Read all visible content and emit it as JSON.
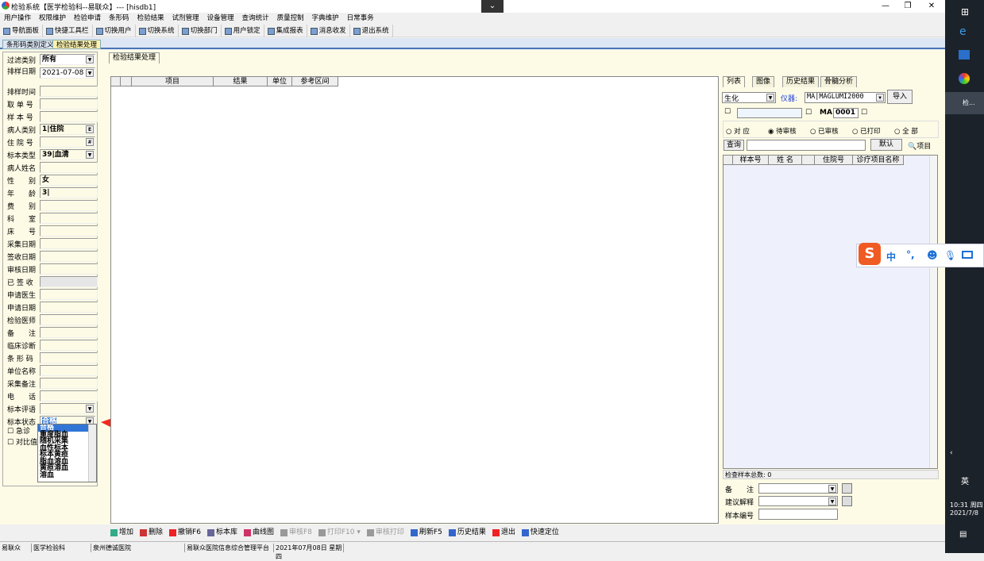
{
  "window": {
    "title": "检验系统【医学检验科--易联众】--- [hisdb1]",
    "minimize": "—",
    "maximize": "❐",
    "close": "✕",
    "collapse": "⌄"
  },
  "menu": [
    "用户操作",
    "权限维护",
    "检验申请",
    "条形码",
    "检验结果",
    "试剂管理",
    "设备管理",
    "查询统计",
    "质量控制",
    "字典维护",
    "日常事务"
  ],
  "toolbar": [
    "导航面板",
    "快捷工具栏",
    "切换用户",
    "切换系统",
    "切换部门",
    "用户锁定",
    "集成报表",
    "消息收发",
    "退出系统"
  ],
  "doc_tabs": [
    {
      "label": "条形码类别定义",
      "active": false
    },
    {
      "label": "检验结果处理",
      "active": true
    }
  ],
  "left": {
    "filter_label": "过滤类别",
    "filter_value": "所有",
    "date_label": "排样日期",
    "date_value": "2021-07-08",
    "fields": [
      {
        "label": "排样时间",
        "value": ""
      },
      {
        "label": "取 单 号",
        "value": ""
      },
      {
        "label": "样 本 号",
        "value": ""
      },
      {
        "label": "病人类别",
        "value": "1|住院",
        "btn": "E"
      },
      {
        "label": "住 院 号",
        "value": "",
        "btn": "#"
      },
      {
        "label": "标本类型",
        "value": "39|血清",
        "dd": true
      },
      {
        "label": "病人姓名",
        "value": ""
      },
      {
        "label": "性　　别",
        "value": "女"
      },
      {
        "label": "年　　龄",
        "value": "3|"
      },
      {
        "label": "费　　别",
        "value": ""
      },
      {
        "label": "科　　室",
        "value": ""
      },
      {
        "label": "床　　号",
        "value": ""
      },
      {
        "label": "采集日期",
        "value": ""
      },
      {
        "label": "签收日期",
        "value": ""
      },
      {
        "label": "审核日期",
        "value": ""
      },
      {
        "label": "已 签 收",
        "value": "",
        "disabled": true
      },
      {
        "label": "申请医生",
        "value": ""
      },
      {
        "label": "申请日期",
        "value": ""
      },
      {
        "label": "检验医师",
        "value": ""
      },
      {
        "label": "备　　注",
        "value": ""
      },
      {
        "label": "临床诊断",
        "value": ""
      },
      {
        "label": "条 形 码",
        "value": ""
      },
      {
        "label": "单位名称",
        "value": ""
      },
      {
        "label": "采集备注",
        "value": ""
      },
      {
        "label": "电　　话",
        "value": ""
      },
      {
        "label": "标本评语",
        "value": "",
        "dd": true
      },
      {
        "label": "标本状态",
        "value": "合格",
        "dd": true,
        "selected": true
      }
    ],
    "urgent_label": "急诊",
    "compare_label": "对比值",
    "status_options": [
      "合格",
      "重度脂血",
      "随机采集",
      "血性标本",
      "标本黄疸",
      "脂血溶血",
      "黄疸溶血",
      "溶血"
    ]
  },
  "main": {
    "tab": "检验结果处理",
    "columns": [
      "",
      "",
      "项目",
      "结果",
      "单位",
      "参考区间"
    ]
  },
  "right": {
    "tabs": [
      "列表",
      "图像",
      "历史结果",
      "骨髓分析"
    ],
    "category": "生化",
    "instrument_label": "仪器:",
    "instrument": "MA|MAGLUMI2000",
    "import": "导入",
    "ma_label": "MA",
    "ma_value": "0001",
    "radios": [
      {
        "label": "对 应",
        "checked": false
      },
      {
        "label": "待审核",
        "checked": true
      },
      {
        "label": "已审核",
        "checked": false
      },
      {
        "label": "已打印",
        "checked": false
      },
      {
        "label": "全 部",
        "checked": false
      }
    ],
    "query": "查询",
    "default": "默认",
    "items": "项目",
    "columns": [
      "",
      "样本号",
      "姓 名",
      "",
      "住院号",
      "诊疗项目名称"
    ],
    "total": "检查样本总数: 0",
    "remark_label": "备　　注",
    "advice_label": "建议解释",
    "sample_no_label": "样本编号"
  },
  "bottom": [
    {
      "label": "增加",
      "enabled": true
    },
    {
      "label": "删除",
      "enabled": true
    },
    {
      "label": "撤销F6",
      "enabled": true
    },
    {
      "label": "标本库",
      "enabled": true
    },
    {
      "label": "曲线图",
      "enabled": true
    },
    {
      "label": "审核F8",
      "enabled": false
    },
    {
      "label": "打印F10 ▾",
      "enabled": false
    },
    {
      "label": "审核打印",
      "enabled": false
    },
    {
      "label": "刷新F5",
      "enabled": true
    },
    {
      "label": "历史结果",
      "enabled": true
    },
    {
      "label": "退出",
      "enabled": true
    },
    {
      "label": "快速定位",
      "enabled": true
    }
  ],
  "status": [
    "易联众",
    "医学检验科",
    "泉州德诚医院",
    "易联众医院信息综合管理平台",
    "2021年07月08日 星期四"
  ],
  "ime": {
    "mode": "中",
    "punct": "°,"
  },
  "taskbar": {
    "app": "检...",
    "lang": "英",
    "time": "10:31 周四",
    "date": "2021/7/8"
  },
  "colors": {
    "accent": "#3176d6",
    "panel": "#fdfbe6",
    "arrow": "#f0291f"
  }
}
